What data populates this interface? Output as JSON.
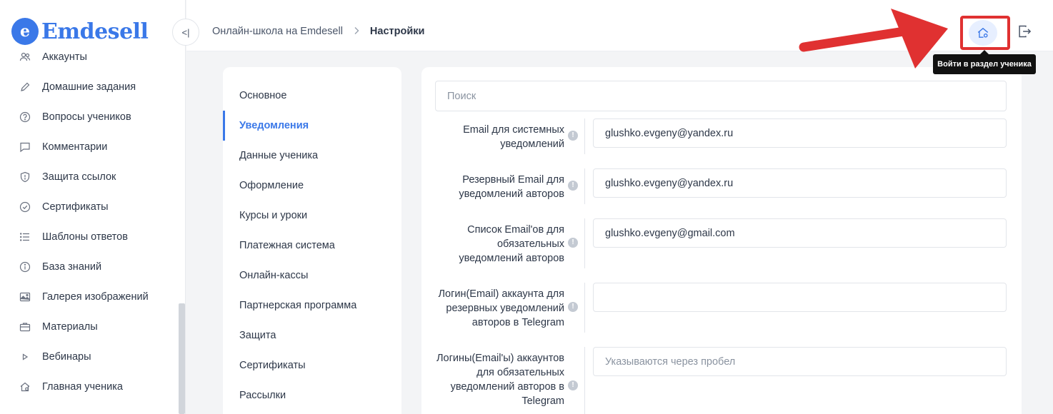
{
  "brand": {
    "logo_letter": "e",
    "name": "Emdesell",
    "color": "#3a78e8"
  },
  "sidebar": {
    "items": [
      {
        "label": "Аккаунты",
        "icon": "users-icon"
      },
      {
        "label": "Домашние задания",
        "icon": "pencil-icon"
      },
      {
        "label": "Вопросы учеников",
        "icon": "question-icon"
      },
      {
        "label": "Комментарии",
        "icon": "comment-icon"
      },
      {
        "label": "Защита ссылок",
        "icon": "shield-icon"
      },
      {
        "label": "Сертификаты",
        "icon": "badge-check-icon"
      },
      {
        "label": "Шаблоны ответов",
        "icon": "list-icon"
      },
      {
        "label": "База знаний",
        "icon": "info-icon"
      },
      {
        "label": "Галерея изображений",
        "icon": "image-icon"
      },
      {
        "label": "Материалы",
        "icon": "briefcase-icon"
      },
      {
        "label": "Вебинары",
        "icon": "play-icon"
      },
      {
        "label": "Главная ученика",
        "icon": "home-icon"
      }
    ]
  },
  "topbar": {
    "collapse_glyph": "<|",
    "breadcrumb": {
      "parent": "Онлайн-школа на Emdesell",
      "current": "Настройки"
    },
    "student_tooltip": "Войти в раздел ученика"
  },
  "settings_menu": {
    "items": [
      {
        "label": "Основное",
        "active": false
      },
      {
        "label": "Уведомления",
        "active": true
      },
      {
        "label": "Данные ученика",
        "active": false
      },
      {
        "label": "Оформление",
        "active": false
      },
      {
        "label": "Курсы и уроки",
        "active": false
      },
      {
        "label": "Платежная система",
        "active": false
      },
      {
        "label": "Онлайн-кассы",
        "active": false
      },
      {
        "label": "Партнерская программа",
        "active": false
      },
      {
        "label": "Защита",
        "active": false
      },
      {
        "label": "Сертификаты",
        "active": false
      },
      {
        "label": "Рассылки",
        "active": false
      }
    ]
  },
  "form": {
    "search_placeholder": "Поиск",
    "fields": [
      {
        "label": "Email для системных уведомлений",
        "value": "glushko.evgeny@yandex.ru",
        "placeholder": ""
      },
      {
        "label": "Резервный Email для уведомлений авторов",
        "value": "glushko.evgeny@yandex.ru",
        "placeholder": ""
      },
      {
        "label": "Список Email'ов для обязательных уведомлений авторов",
        "value": "glushko.evgeny@gmail.com",
        "placeholder": ""
      },
      {
        "label": "Логин(Email) аккаунта для резервных уведомлений авторов в Telegram",
        "value": "",
        "placeholder": ""
      },
      {
        "label": "Логины(Email'ы) аккаунтов для обязательных уведомлений авторов в Telegram",
        "value": "",
        "placeholder": "Указываются через пробел"
      }
    ]
  },
  "annotation": {
    "highlight_color": "#e03131"
  }
}
